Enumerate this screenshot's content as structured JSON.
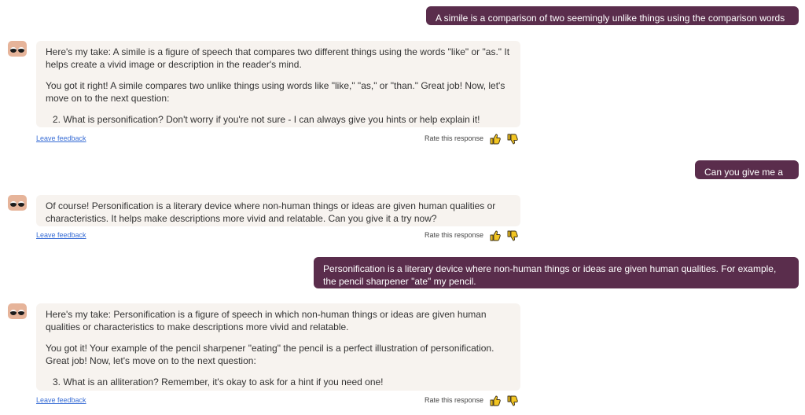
{
  "messages": {
    "user1": {
      "text": "A simile is a comparison of two seemingly unlike things using the comparison words like, as, or than."
    },
    "bot1": {
      "p1": "Here's my take: A simile is a figure of speech that compares two different things using the words \"like\" or \"as.\" It helps create a vivid image or description in the reader's mind.",
      "p2": "You got it right! A simile compares two unlike things using words like \"like,\" \"as,\" or \"than.\" Great job! Now, let's move on to the next question:",
      "p3": "2. What is personification? Don't worry if you're not sure - I can always give you hints or help explain it!"
    },
    "user2": {
      "text": "Can you give me a hint?"
    },
    "bot2": {
      "p1": "Of course! Personification is a literary device where non-human things or ideas are given human qualities or characteristics. It helps make descriptions more vivid and relatable. Can you give it a try now?"
    },
    "user3": {
      "text": "Personification is a literary device where non-human things or ideas are given human qualities. For example, the pencil sharpener \"ate\" my pencil."
    },
    "bot3": {
      "p1": "Here's my take: Personification is a figure of speech in which non-human things or ideas are given human qualities or characteristics to make descriptions more vivid and relatable.",
      "p2": "You got it! Your example of the pencil sharpener \"eating\" the pencil is a perfect illustration of personification. Great job! Now, let's move on to the next question:",
      "p3": "3. What is an alliteration? Remember, it's okay to ask for a hint if you need one!"
    }
  },
  "feedback": {
    "leave_feedback": "Leave feedback",
    "rate_label": "Rate this response"
  },
  "colors": {
    "user_bubble": "#5a2d4c",
    "bot_bubble": "#f7f3ef",
    "thumb_fill": "#f2c522",
    "link": "#3b6fd6",
    "avatar": "#e6b49a"
  },
  "icons": {
    "avatar": "bot-avatar-icon",
    "thumbs_up": "thumbs-up-icon",
    "thumbs_down": "thumbs-down-icon"
  }
}
